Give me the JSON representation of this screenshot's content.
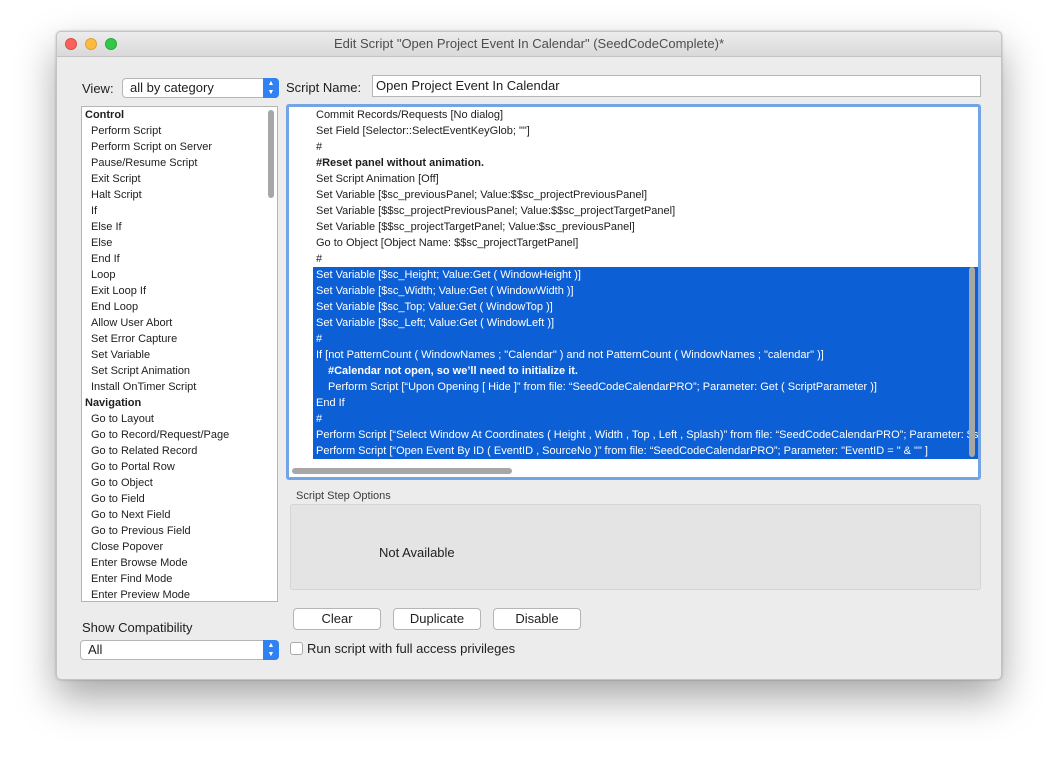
{
  "window": {
    "title": "Edit Script \"Open Project Event In Calendar\" (SeedCodeComplete)*"
  },
  "view": {
    "label": "View:",
    "selected": "all by category"
  },
  "script_name": {
    "label": "Script Name:",
    "value": "Open Project Event In Calendar"
  },
  "steps": [
    {
      "label": "Control",
      "category": true
    },
    {
      "label": "Perform Script"
    },
    {
      "label": "Perform Script on Server"
    },
    {
      "label": "Pause/Resume Script"
    },
    {
      "label": "Exit Script"
    },
    {
      "label": "Halt Script"
    },
    {
      "label": "If"
    },
    {
      "label": "Else If"
    },
    {
      "label": "Else"
    },
    {
      "label": "End If"
    },
    {
      "label": "Loop"
    },
    {
      "label": "Exit Loop If"
    },
    {
      "label": "End Loop"
    },
    {
      "label": "Allow User Abort"
    },
    {
      "label": "Set Error Capture"
    },
    {
      "label": "Set Variable"
    },
    {
      "label": "Set Script Animation"
    },
    {
      "label": "Install OnTimer Script"
    },
    {
      "label": "Navigation",
      "category": true
    },
    {
      "label": "Go to Layout"
    },
    {
      "label": "Go to Record/Request/Page"
    },
    {
      "label": "Go to Related Record"
    },
    {
      "label": "Go to Portal Row"
    },
    {
      "label": "Go to Object"
    },
    {
      "label": "Go to Field"
    },
    {
      "label": "Go to Next Field"
    },
    {
      "label": "Go to Previous Field"
    },
    {
      "label": "Close Popover"
    },
    {
      "label": "Enter Browse Mode"
    },
    {
      "label": "Enter Find Mode"
    },
    {
      "label": "Enter Preview Mode"
    }
  ],
  "script_lines": [
    {
      "text": "Commit Records/Requests [No dialog]"
    },
    {
      "text": "Set Field [Selector::SelectEventKeyGlob; \"\"]"
    },
    {
      "text": "#"
    },
    {
      "text": "#Reset panel without animation.",
      "bold": true
    },
    {
      "text": "Set Script Animation [Off]"
    },
    {
      "text": "Set Variable [$sc_previousPanel; Value:$$sc_projectPreviousPanel]"
    },
    {
      "text": "Set Variable [$$sc_projectPreviousPanel; Value:$$sc_projectTargetPanel]"
    },
    {
      "text": "Set Variable [$$sc_projectTargetPanel; Value:$sc_previousPanel]"
    },
    {
      "text": "Go to Object [Object Name: $$sc_projectTargetPanel]"
    },
    {
      "text": "#"
    },
    {
      "text": "Set Variable [$sc_Height; Value:Get ( WindowHeight )]",
      "selected": true
    },
    {
      "text": "Set Variable [$sc_Width; Value:Get ( WindowWidth )]",
      "selected": true
    },
    {
      "text": "Set Variable [$sc_Top; Value:Get ( WindowTop )]",
      "selected": true
    },
    {
      "text": "Set Variable [$sc_Left; Value:Get ( WindowLeft )]",
      "selected": true
    },
    {
      "text": "#",
      "selected": true
    },
    {
      "text": "If [not PatternCount ( WindowNames ; \"Calendar\" )  and not PatternCount ( WindowNames ; \"calendar\" )]",
      "selected": true
    },
    {
      "text": "#Calendar not open, so we’ll need to initialize it.",
      "selected": true,
      "bold": true,
      "indent": 1
    },
    {
      "text": "Perform Script [“Upon Opening [ Hide ]” from file: “SeedCodeCalendarPRO”; Parameter: Get ( ScriptParameter )]",
      "selected": true,
      "indent": 1
    },
    {
      "text": "End If",
      "selected": true
    },
    {
      "text": "#",
      "selected": true
    },
    {
      "text": "Perform Script [“Select Window  At Coordinates ( Height , Width , Top ,  Left , Splash)” from file: “SeedCodeCalendarPRO”; Parameter: $sc_Height & \"|\" & $sc_Width & \"|\" & $sc_Top & \"|\" & $sc_Left]",
      "selected": true
    },
    {
      "text": "Perform Script [“Open Event By ID ( EventID , SourceNo )” from file: “SeedCodeCalendarPRO”; Parameter: \"EventID = \" & \"\" ]",
      "selected": true
    }
  ],
  "step_options": {
    "label": "Script Step Options",
    "value": "Not Available"
  },
  "buttons": {
    "clear": "Clear",
    "duplicate": "Duplicate",
    "disable": "Disable"
  },
  "compatibility": {
    "label": "Show Compatibility",
    "selected": "All"
  },
  "full_access": {
    "label": "Run script with full access privileges",
    "checked": false
  }
}
